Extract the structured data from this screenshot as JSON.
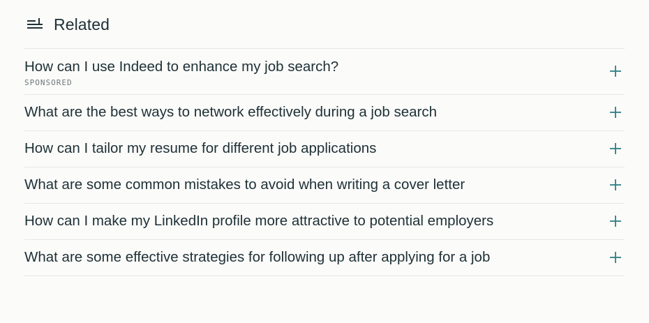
{
  "related": {
    "title": "Related",
    "header_icon": "list-plus-icon",
    "plus_icon": "plus-icon",
    "accent_color": "#2e7d84",
    "items": [
      {
        "text": "How can I use Indeed to enhance my job search?",
        "sub": "SPONSORED"
      },
      {
        "text": "What are the best ways to network effectively during a job search"
      },
      {
        "text": "How can I tailor my resume for different job applications"
      },
      {
        "text": "What are some common mistakes to avoid when writing a cover letter"
      },
      {
        "text": "How can I make my LinkedIn profile more attractive to potential employers"
      },
      {
        "text": "What are some effective strategies for following up after applying for a job"
      }
    ]
  }
}
